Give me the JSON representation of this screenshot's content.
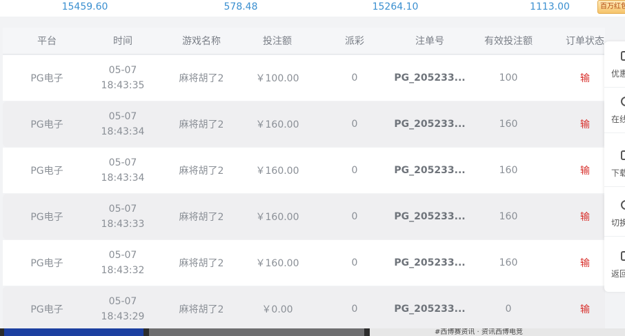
{
  "summary": {
    "values": [
      "15459.60",
      "578.48",
      "15264.10",
      "1113.00"
    ],
    "badge": "百万红包"
  },
  "table": {
    "headers": [
      "平台",
      "时间",
      "游戏名称",
      "投注额",
      "派彩",
      "注单号",
      "有效投注额",
      "订单状态"
    ],
    "rows": [
      {
        "platform": "PG电子",
        "date": "05-07",
        "time": "18:43:35",
        "game": "麻将胡了2",
        "bet": "￥100.00",
        "payout": "0",
        "order": "PG_205233...",
        "valid": "100",
        "status": "输"
      },
      {
        "platform": "PG电子",
        "date": "05-07",
        "time": "18:43:34",
        "game": "麻将胡了2",
        "bet": "￥160.00",
        "payout": "0",
        "order": "PG_205233...",
        "valid": "160",
        "status": "输"
      },
      {
        "platform": "PG电子",
        "date": "05-07",
        "time": "18:43:34",
        "game": "麻将胡了2",
        "bet": "￥160.00",
        "payout": "0",
        "order": "PG_205233...",
        "valid": "160",
        "status": "输"
      },
      {
        "platform": "PG电子",
        "date": "05-07",
        "time": "18:43:33",
        "game": "麻将胡了2",
        "bet": "￥160.00",
        "payout": "0",
        "order": "PG_205233...",
        "valid": "160",
        "status": "输"
      },
      {
        "platform": "PG电子",
        "date": "05-07",
        "time": "18:43:32",
        "game": "麻将胡了2",
        "bet": "￥160.00",
        "payout": "0",
        "order": "PG_205233...",
        "valid": "160",
        "status": "输"
      },
      {
        "platform": "PG电子",
        "date": "05-07",
        "time": "18:43:29",
        "game": "麻将胡了2",
        "bet": "￥0.00",
        "payout": "0",
        "order": "PG_205233...",
        "valid": "0",
        "status": "输"
      }
    ]
  },
  "side_panel": {
    "items": [
      {
        "label": "优惠",
        "icon": "gift-icon"
      },
      {
        "label": "在线",
        "icon": "chat-icon"
      },
      {
        "label": "下载",
        "icon": "phone-icon"
      },
      {
        "label": "切换",
        "icon": "switch-icon"
      },
      {
        "label": "返回",
        "icon": "back-top-icon"
      }
    ]
  },
  "bottom_strip": {
    "news": "#西博赛资讯 · 资讯西博电竞"
  },
  "colors": {
    "accent": "#3a8fd0",
    "lose": "#d8322e",
    "row_alt": "#efeff1"
  }
}
